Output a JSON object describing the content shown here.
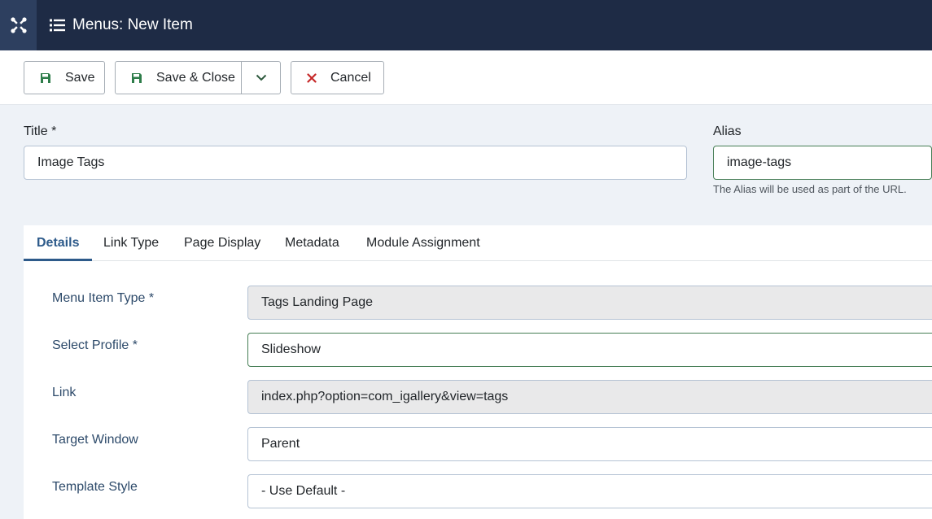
{
  "header": {
    "title": "Menus: New Item",
    "logo_icon": "joomla-logo-icon",
    "title_icon": "list-icon"
  },
  "toolbar": {
    "save_label": "Save",
    "save_close_label": "Save & Close",
    "cancel_label": "Cancel"
  },
  "form": {
    "title_label": "Title *",
    "title_value": "Image Tags",
    "alias_label": "Alias",
    "alias_value": "image-tags",
    "alias_hint": "The Alias will be used as part of the URL."
  },
  "tabs": [
    {
      "label": "Details"
    },
    {
      "label": "Link Type"
    },
    {
      "label": "Page Display"
    },
    {
      "label": "Metadata"
    },
    {
      "label": "Module Assignment"
    }
  ],
  "details": [
    {
      "label": "Menu Item Type *",
      "value": "Tags Landing Page"
    },
    {
      "label": "Select Profile *",
      "value": "Slideshow"
    },
    {
      "label": "Link",
      "value": "index.php?option=com_igallery&view=tags"
    },
    {
      "label": "Target Window",
      "value": "Parent"
    },
    {
      "label": "Template Style",
      "value": "- Use Default -"
    }
  ],
  "colors": {
    "header_bg": "#1e2b45",
    "accent": "#2d5a8a",
    "save_icon": "#2e7d4a",
    "cancel_icon": "#c62828"
  }
}
